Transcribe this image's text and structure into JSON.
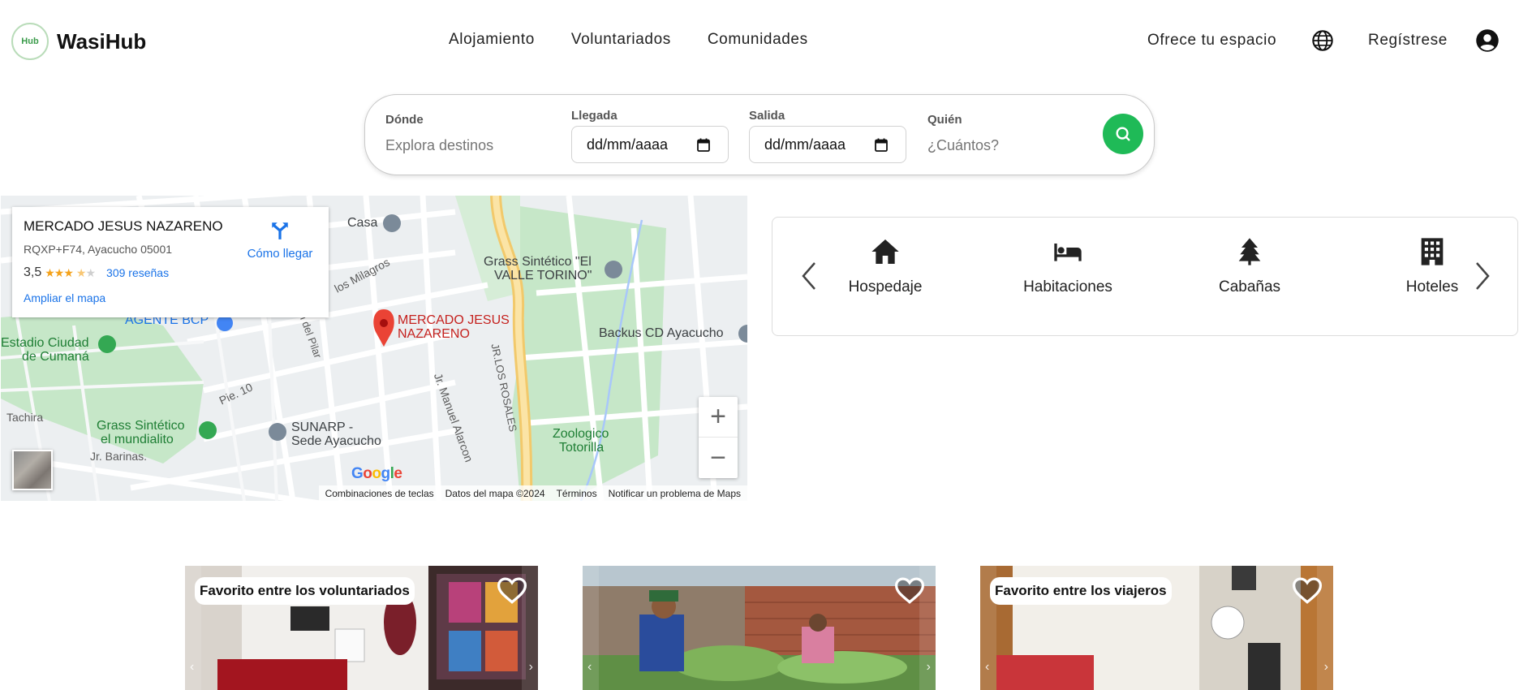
{
  "brand": {
    "name": "WasiHub",
    "logo_text": "Hub"
  },
  "nav": {
    "items": [
      "Alojamiento",
      "Voluntariados",
      "Comunidades"
    ],
    "offer_label": "Ofrece tu espacio",
    "register_label": "Regístrese"
  },
  "search": {
    "where_label": "Dónde",
    "where_placeholder": "Explora destinos",
    "arrival_label": "Llegada",
    "arrival_value": "dd/mm/aaaa",
    "departure_label": "Salida",
    "departure_value": "dd/mm/aaaa",
    "who_label": "Quién",
    "who_placeholder": "¿Cuántos?"
  },
  "map": {
    "place_name": "MERCADO JESUS NAZARENO",
    "address": "RQXP+F74, Ayacucho 05001",
    "rating": "3,5",
    "reviews": "309 reseñas",
    "directions_label": "Cómo llegar",
    "enlarge_label": "Ampliar el mapa",
    "zoom_in": "+",
    "zoom_out": "−",
    "google": "Google",
    "footer": [
      "Combinaciones de teclas",
      "Datos del mapa ©2024",
      "Términos",
      "Notificar un problema de Maps"
    ],
    "labels": {
      "casa": "Casa",
      "grass_valle_1": "Grass Sintético \"El",
      "grass_valle_2": "VALLE TORINO\"",
      "milagros": "los Milagros",
      "agente": "AGENTE BCP",
      "estadio_1": "Estadio Ciudad",
      "estadio_2": "de Cumaná",
      "mercado_1": "MERCADO JESUS",
      "mercado_2": "NAZARENO",
      "backus": "Backus CD Ayacucho",
      "pilar": "rgen del Pilar",
      "pie": "Pie. 10",
      "tachira": "Tachira",
      "grass_mundialito_1": "Grass Sintético",
      "grass_mundialito_2": "el mundialito",
      "sunarp_1": "SUNARP -",
      "sunarp_2": "Sede Ayacucho",
      "alarcon": "Jr. Manuel Alarcon",
      "rosales": "JR.LOS ROSALES",
      "zoo_1": "Zoologico",
      "zoo_2": "Totorilla",
      "barinas": "Jr. Barinas."
    }
  },
  "categories": {
    "items": [
      {
        "label": "Hospedaje",
        "icon": "home-icon"
      },
      {
        "label": "Habitaciones",
        "icon": "bed-icon"
      },
      {
        "label": "Cabañas",
        "icon": "tree-icon"
      },
      {
        "label": "Hoteles",
        "icon": "building-icon"
      }
    ]
  },
  "listings": [
    {
      "badge": "Favorito entre los voluntariados"
    },
    {
      "badge": ""
    },
    {
      "badge": "Favorito entre los viajeros"
    }
  ],
  "colors": {
    "accent": "#1fba57",
    "link": "#1a73e8",
    "pin": "#ea4335"
  }
}
